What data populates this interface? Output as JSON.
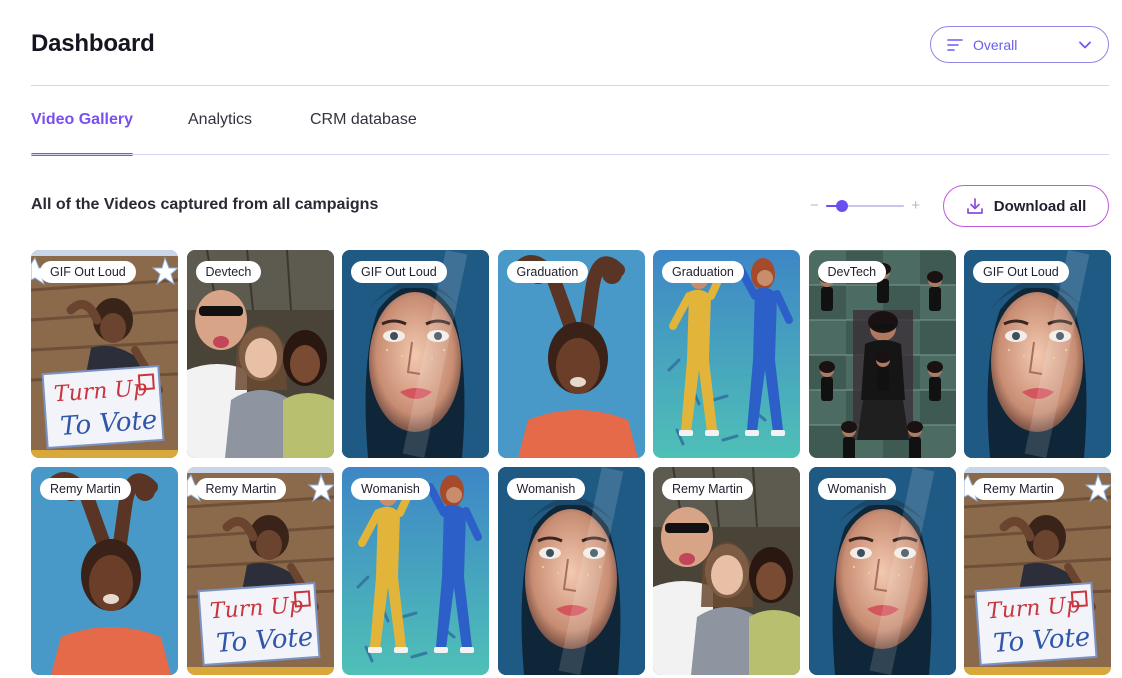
{
  "header": {
    "title": "Dashboard",
    "filter": {
      "selected": "Overall",
      "icon": "filter-lines-icon",
      "chevron": "chevron-down-icon"
    }
  },
  "tabs": [
    {
      "label": "Video Gallery",
      "active": true
    },
    {
      "label": "Analytics",
      "active": false
    },
    {
      "label": "CRM database",
      "active": false
    }
  ],
  "gallery": {
    "title": "All of the Videos captured from all campaigns",
    "zoom": {
      "minus": "−",
      "plus": "+",
      "level": 0.2
    },
    "download": {
      "label": "Download all",
      "icon": "download-icon"
    },
    "items": [
      {
        "tag": "GIF Out Loud",
        "theme": "vote"
      },
      {
        "tag": "Devtech",
        "theme": "selfie"
      },
      {
        "tag": "GIF Out Loud",
        "theme": "portrait"
      },
      {
        "tag": "Graduation",
        "theme": "dance"
      },
      {
        "tag": "Graduation",
        "theme": "jumpsuit"
      },
      {
        "tag": "DevTech",
        "theme": "mirror"
      },
      {
        "tag": "GIF Out Loud",
        "theme": "portrait"
      },
      {
        "tag": "Remy Martin",
        "theme": "dance"
      },
      {
        "tag": "Remy Martin",
        "theme": "vote"
      },
      {
        "tag": "Womanish",
        "theme": "jumpsuit"
      },
      {
        "tag": "Womanish",
        "theme": "portrait"
      },
      {
        "tag": "Remy Martin",
        "theme": "selfie"
      },
      {
        "tag": "Womanish",
        "theme": "portrait"
      },
      {
        "tag": "Remy Martin",
        "theme": "vote"
      }
    ],
    "vote_sign": {
      "line1": "Turn Up",
      "line2": "To Vote"
    }
  },
  "colors": {
    "accent": "#7a4ff0",
    "border": "#8f88e8",
    "download_border": "#c158e0"
  }
}
